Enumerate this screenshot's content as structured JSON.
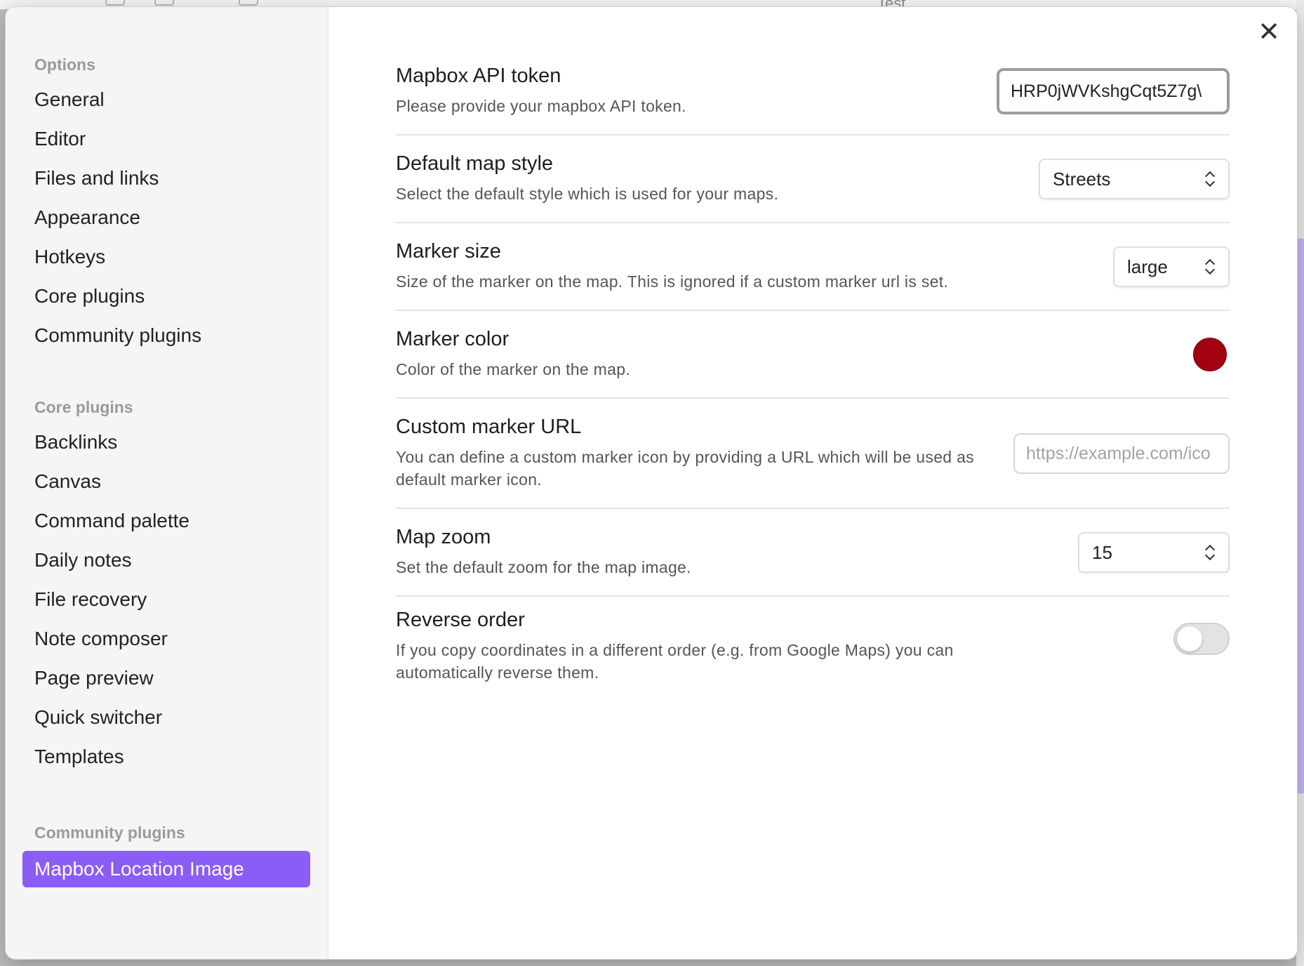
{
  "background": {
    "title": "Test"
  },
  "sidebar": {
    "groups": [
      {
        "title": "Options",
        "items": [
          "General",
          "Editor",
          "Files and links",
          "Appearance",
          "Hotkeys",
          "Core plugins",
          "Community plugins"
        ]
      },
      {
        "title": "Core plugins",
        "items": [
          "Backlinks",
          "Canvas",
          "Command palette",
          "Daily notes",
          "File recovery",
          "Note composer",
          "Page preview",
          "Quick switcher",
          "Templates"
        ]
      },
      {
        "title": "Community plugins",
        "items": [
          "Mapbox Location Image"
        ]
      }
    ],
    "active_item": "Mapbox Location Image",
    "accent_color": "#8b5cf6"
  },
  "close_icon": "close-icon",
  "settings": {
    "api_token": {
      "name": "Mapbox API token",
      "desc": "Please provide your mapbox API token.",
      "value": "\\HRP0jWVKshgCqt5Z7g"
    },
    "map_style": {
      "name": "Default map style",
      "desc": "Select the default style which is used for your maps.",
      "value": "Streets"
    },
    "marker_size": {
      "name": "Marker size",
      "desc": "Size of the marker on the map. This is ignored if a custom marker url is set.",
      "value": "large"
    },
    "marker_color": {
      "name": "Marker color",
      "desc": "Color of the marker on the map.",
      "color": "#a30010"
    },
    "custom_marker": {
      "name": "Custom marker URL",
      "desc": "You can define a custom marker icon by providing a URL which will be used as default marker icon.",
      "placeholder": "https://example.com/ico"
    },
    "map_zoom": {
      "name": "Map zoom",
      "desc": "Set the default zoom for the map image.",
      "value": "15"
    },
    "reverse_order": {
      "name": "Reverse order",
      "desc": "If you copy coordinates in a different order (e.g. from Google Maps) you can automatically reverse them.",
      "enabled": false
    }
  }
}
